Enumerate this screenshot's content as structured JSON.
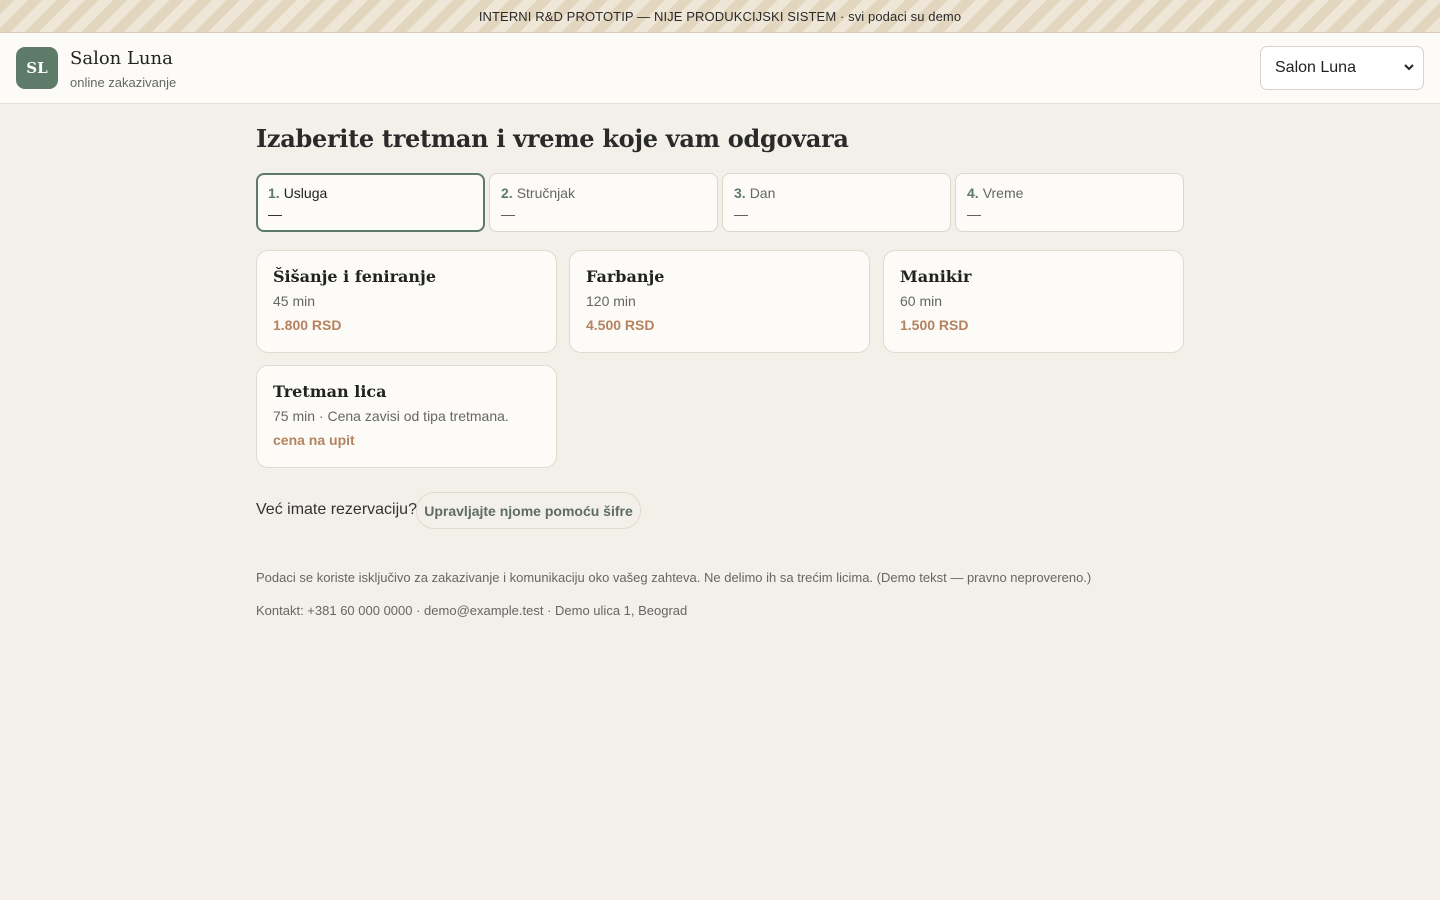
{
  "banner": "INTERNI R&D PROTOTIP — NIJE PRODUKCIJSKI SISTEM · svi podaci su demo",
  "brand": {
    "initials": "SL",
    "name": "Salon Luna",
    "tagline": "online zakazivanje"
  },
  "salon_selector": {
    "value": "Salon Luna"
  },
  "page_title": "Izaberite tretman i vreme koje vam odgovara",
  "steps": [
    {
      "num": "1.",
      "label": "Usluga",
      "value": "—",
      "active": true
    },
    {
      "num": "2.",
      "label": "Stručnjak",
      "value": "—",
      "active": false
    },
    {
      "num": "3.",
      "label": "Dan",
      "value": "—",
      "active": false
    },
    {
      "num": "4.",
      "label": "Vreme",
      "value": "—",
      "active": false
    }
  ],
  "services": [
    {
      "name": "Šišanje i feniranje",
      "meta": "45 min",
      "price": "1.800 RSD"
    },
    {
      "name": "Farbanje",
      "meta": "120 min",
      "price": "4.500 RSD"
    },
    {
      "name": "Manikir",
      "meta": "60 min",
      "price": "1.500 RSD"
    },
    {
      "name": "Tretman lica",
      "meta": "75 min · Cena zavisi od tipa tretmana.",
      "price": "cena na upit"
    }
  ],
  "existing_booking": {
    "text": "Već imate rezervaciju?",
    "button": "Upravljajte njome pomoću šifre"
  },
  "footer": {
    "privacy": "Podaci se koriste isključivo za zakazivanje i komunikaciju oko vašeg zahteva. Ne delimo ih sa trećim licima. (Demo tekst — pravno neprovereno.)",
    "contact": "Kontakt: +381 60 000 0000 · demo@example.test · Demo ulica 1, Beograd"
  },
  "colors": {
    "accent": "#5e7a68",
    "price": "#b5835f",
    "background": "#f3f0ea"
  }
}
